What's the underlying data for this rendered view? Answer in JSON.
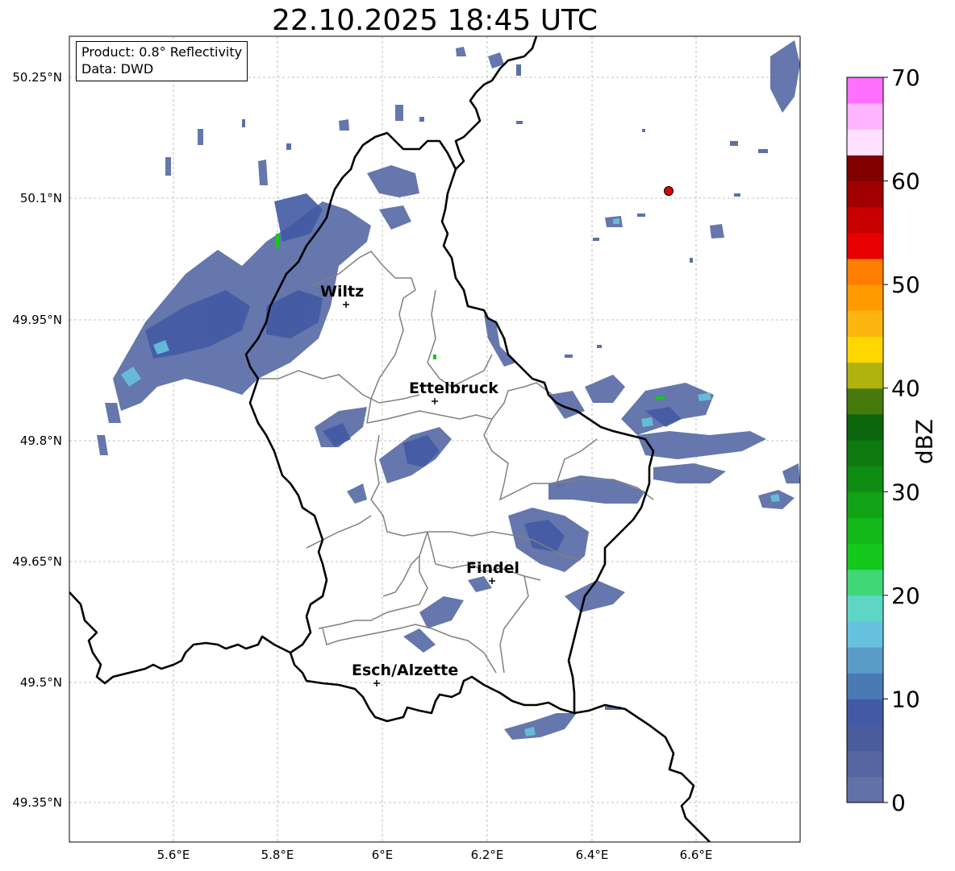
{
  "title": "22.10.2025 18:45 UTC",
  "info": {
    "product": "Product: 0.8° Reflectivity",
    "data": "Data: DWD"
  },
  "lat_ticks": [
    "50.25°N",
    "50.1°N",
    "49.95°N",
    "49.8°N",
    "49.65°N",
    "49.5°N",
    "49.35°N"
  ],
  "lon_ticks": [
    "5.6°E",
    "5.8°E",
    "6°E",
    "6.2°E",
    "6.4°E",
    "6.6°E"
  ],
  "cities": [
    {
      "name": "Wiltz",
      "lon": 5.93,
      "lat": 49.97
    },
    {
      "name": "Ettelbruck",
      "lon": 6.1,
      "lat": 49.85
    },
    {
      "name": "Findel",
      "lon": 6.21,
      "lat": 49.63
    },
    {
      "name": "Esch/Alzette",
      "lon": 5.99,
      "lat": 49.5
    }
  ],
  "marker": {
    "lon": 6.55,
    "lat": 50.11,
    "color": "#e00000"
  },
  "extent": {
    "lon": [
      5.4,
      6.8
    ],
    "lat": [
      49.3,
      50.3
    ]
  },
  "colorbar": {
    "label": "dBZ",
    "ticks": [
      "0",
      "10",
      "20",
      "30",
      "40",
      "50",
      "60",
      "70"
    ],
    "min": 0,
    "max": 70,
    "step": 2.5,
    "colors": [
      "#6272a8",
      "#56659f",
      "#4a5c9c",
      "#425aa5",
      "#4b79b5",
      "#5b9bc8",
      "#66c2dc",
      "#5dd6c6",
      "#40d778",
      "#14c81e",
      "#12b918",
      "#11a315",
      "#0f8c12",
      "#0c7a0f",
      "#0a650d",
      "#467a0c",
      "#b1b20d",
      "#ffd700",
      "#fdb610",
      "#ff9a00",
      "#ff7d00",
      "#e60000",
      "#c80000",
      "#a00000",
      "#800000",
      "#ffe0ff",
      "#ffb4ff",
      "#ff70ff",
      "#e83de8"
    ]
  },
  "colors": {
    "echo_light": "#5d70a8",
    "echo_mid": "#4a5c9c",
    "echo_cyan": "#66c2dc",
    "echo_green": "#14c81e",
    "border_national": "#000000",
    "border_canton": "#808080",
    "grid": "#b0b0b0"
  }
}
